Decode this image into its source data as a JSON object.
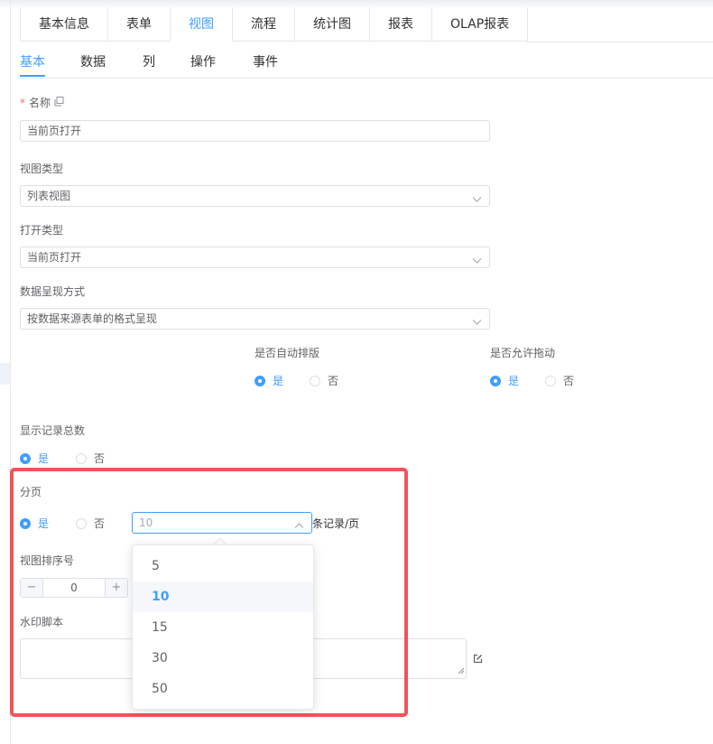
{
  "top_tabs": {
    "items": [
      "基本信息",
      "表单",
      "视图",
      "流程",
      "统计图",
      "报表",
      "OLAP报表"
    ]
  },
  "sub_tabs": {
    "items": [
      "基本",
      "数据",
      "列",
      "操作",
      "事件"
    ]
  },
  "form": {
    "name": {
      "required_mark": "*",
      "label": "名称",
      "value": "当前页打开"
    },
    "view_type": {
      "label": "视图类型",
      "value": "列表视图"
    },
    "open_type": {
      "label": "打开类型",
      "value": "当前页打开"
    },
    "data_display": {
      "label": "数据呈现方式",
      "value": "按数据来源表单的格式呈现"
    },
    "auto_layout": {
      "label": "是否自动排版",
      "yes": "是",
      "no": "否",
      "selected": "是"
    },
    "allow_drag": {
      "label": "是否允许拖动",
      "yes": "是",
      "no": "否",
      "selected": "是"
    },
    "show_total": {
      "label": "显示记录总数",
      "yes": "是",
      "no": "否",
      "selected": "是"
    },
    "paging": {
      "label": "分页",
      "yes": "是",
      "no": "否",
      "selected": "是",
      "page_size_placeholder": "10",
      "unit": "条记录/页"
    },
    "sort_no": {
      "label": "视图排序号",
      "value": "0",
      "minus": "−",
      "plus": "+"
    },
    "watermark": {
      "label": "水印脚本",
      "value": ""
    }
  },
  "page_size_dropdown": {
    "options": [
      "5",
      "10",
      "15",
      "30",
      "50"
    ],
    "selected": "10"
  },
  "colors": {
    "accent": "#409eff",
    "highlight": "#f0545a",
    "required": "#f56c6c"
  },
  "icons": {
    "copy": "copy-icon",
    "select_arrow": "chevron-down-icon",
    "open_arrow": "chevron-up-icon",
    "edit": "edit-icon"
  }
}
